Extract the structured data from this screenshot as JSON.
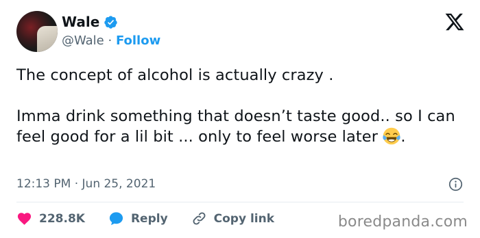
{
  "author": {
    "name": "Wale",
    "handle": "@Wale",
    "separator": " · ",
    "follow_label": "Follow"
  },
  "tweet": {
    "text": "The concept of alcohol is actually crazy .\n\nImma drink something that doesn’t taste good.. so I can  feel good for a lil bit ... only to feel worse later ",
    "trailing": ".",
    "emoji": "face-with-tears-of-joy",
    "timestamp": "12:13 PM · Jun 25, 2021"
  },
  "actions": {
    "likes": "228.8K",
    "reply_label": "Reply",
    "copy_link_label": "Copy link"
  },
  "watermark": "boredpanda.com",
  "colors": {
    "accent": "#1d9bf0",
    "like": "#f91880",
    "muted": "#536471",
    "text": "#0f1419"
  },
  "icons": [
    "verified-badge-icon",
    "x-logo-icon",
    "info-icon",
    "heart-icon",
    "reply-bubble-icon",
    "link-icon"
  ]
}
